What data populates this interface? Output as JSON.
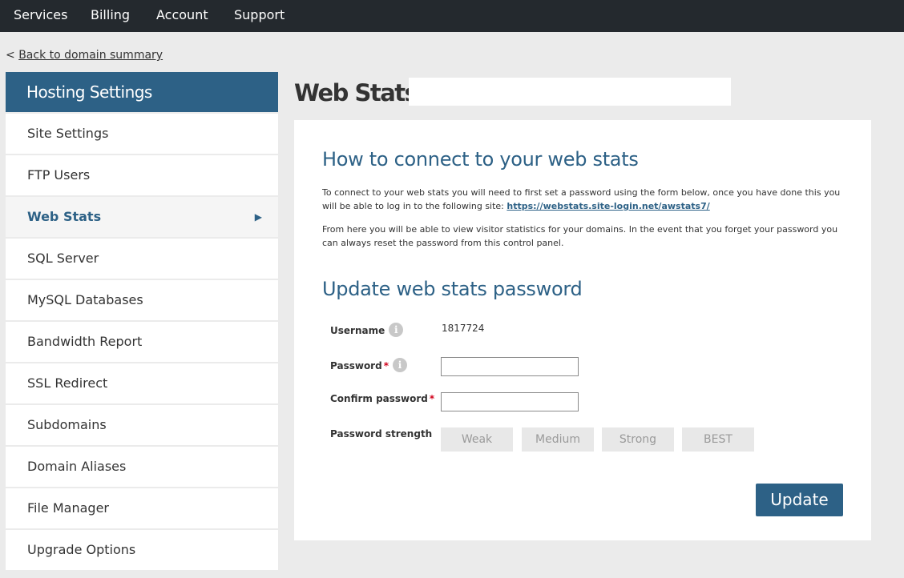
{
  "topnav": {
    "items": [
      {
        "label": "Services"
      },
      {
        "label": "Billing"
      },
      {
        "label": "Account"
      },
      {
        "label": "Support"
      }
    ]
  },
  "back": {
    "prefix": "<",
    "label": "Back to domain summary"
  },
  "sidebar": {
    "title": "Hosting Settings",
    "items": [
      {
        "label": "Site Settings"
      },
      {
        "label": "FTP Users"
      },
      {
        "label": "Web Stats",
        "active": true
      },
      {
        "label": "SQL Server"
      },
      {
        "label": "MySQL Databases"
      },
      {
        "label": "Bandwidth Report"
      },
      {
        "label": "SSL Redirect"
      },
      {
        "label": "Subdomains"
      },
      {
        "label": "Domain Aliases"
      },
      {
        "label": "File Manager"
      },
      {
        "label": "Upgrade Options"
      }
    ],
    "active_arrow": "▶"
  },
  "page": {
    "title": "Web Stats:"
  },
  "connect": {
    "heading": "How to connect to your web stats",
    "para1_text": "To connect to your web stats you will need to first set a password using the form below, once you have done this you will be able to log in to the following site: ",
    "para1_link": "https://webstats.site-login.net/awstats7/",
    "para2": "From here you will be able to view visitor statistics for your domains. In the event that you forget your password you can always reset the password from this control panel."
  },
  "form": {
    "heading": "Update web stats password",
    "username_label": "Username",
    "username_value": "1817724",
    "password_label": "Password",
    "confirm_label": "Confirm password",
    "required_mark": "*",
    "strength_label": "Password strength",
    "strength_levels": [
      "Weak",
      "Medium",
      "Strong",
      "BEST"
    ],
    "info_glyph": "i",
    "submit_label": "Update"
  },
  "colors": {
    "accent": "#2d6186",
    "topbar": "#24292e",
    "required": "#d0021b"
  }
}
